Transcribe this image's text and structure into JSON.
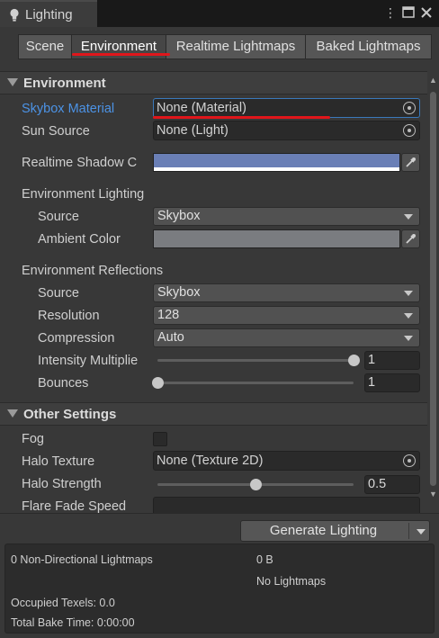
{
  "window": {
    "tab_title": "Lighting"
  },
  "tabs": [
    {
      "label": "Scene"
    },
    {
      "label": "Environment"
    },
    {
      "label": "Realtime Lightmaps"
    },
    {
      "label": "Baked Lightmaps"
    }
  ],
  "environment": {
    "header": "Environment",
    "skybox_material": {
      "label": "Skybox Material",
      "value": "None (Material)"
    },
    "sun_source": {
      "label": "Sun Source",
      "value": "None (Light)"
    },
    "realtime_shadow": {
      "label": "Realtime Shadow C",
      "color": "#6a7fb6"
    },
    "env_lighting": {
      "heading": "Environment Lighting",
      "source": {
        "label": "Source",
        "value": "Skybox"
      },
      "ambient_color": {
        "label": "Ambient Color",
        "color": "#7a7c80"
      }
    },
    "env_reflections": {
      "heading": "Environment Reflections",
      "source": {
        "label": "Source",
        "value": "Skybox"
      },
      "resolution": {
        "label": "Resolution",
        "value": "128"
      },
      "compression": {
        "label": "Compression",
        "value": "Auto"
      },
      "intensity": {
        "label": "Intensity Multiplie",
        "value": "1",
        "fraction": 1.0
      },
      "bounces": {
        "label": "Bounces",
        "value": "1",
        "fraction": 0.0
      }
    }
  },
  "other_settings": {
    "header": "Other Settings",
    "fog": {
      "label": "Fog",
      "checked": false
    },
    "halo_texture": {
      "label": "Halo Texture",
      "value": "None (Texture 2D)"
    },
    "halo_strength": {
      "label": "Halo Strength",
      "value": "0.5",
      "fraction": 0.5
    },
    "flare_fade": {
      "label": "Flare Fade Speed"
    }
  },
  "generate": {
    "label": "Generate Lighting"
  },
  "stats": {
    "lightmaps": "0 Non-Directional Lightmaps",
    "size": "0 B",
    "no_lightmaps": "No Lightmaps",
    "texels": "Occupied Texels: 0.0",
    "bake_time": "Total Bake Time: 0:00:00"
  },
  "colors": {
    "accent_blue": "#4c93e6",
    "annotation_red": "#e0161b"
  }
}
